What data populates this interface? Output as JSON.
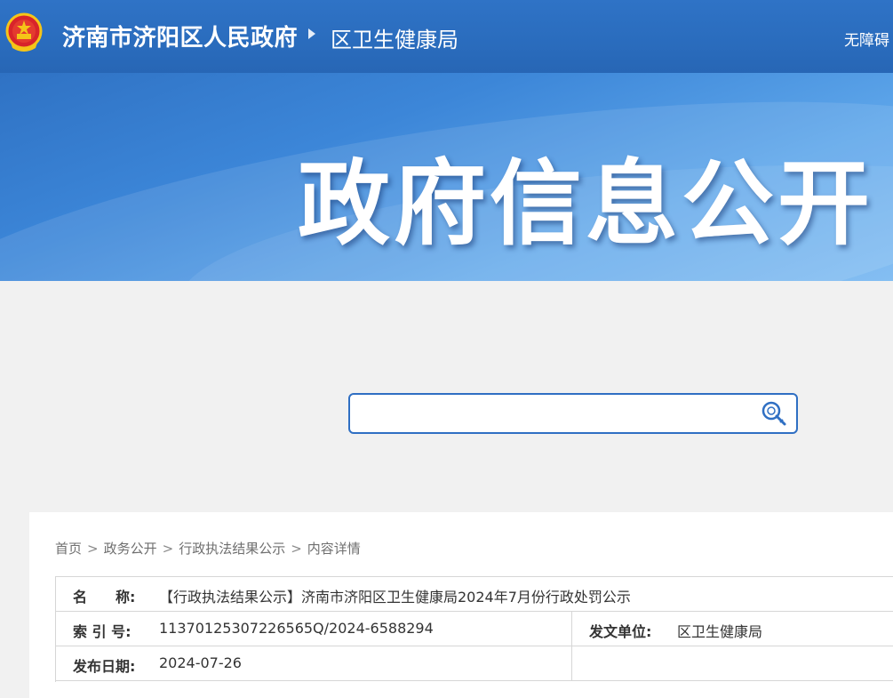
{
  "header": {
    "site_name": "济南市济阳区人民政府",
    "department": "区卫生健康局",
    "accessibility_link": "无障碍"
  },
  "banner": {
    "title": "政府信息公开"
  },
  "search": {
    "placeholder": ""
  },
  "breadcrumb": {
    "items": [
      "首页",
      "政务公开",
      "行政执法结果公示",
      "内容详情"
    ],
    "separator": ">"
  },
  "document_meta": {
    "name_label": "名　　称:",
    "name_value": "【行政执法结果公示】济南市济阳区卫生健康局2024年7月份行政处罚公示",
    "index_label": "索 引 号:",
    "index_value": "11370125307226565Q/2024-6588294",
    "issuer_label": "发文单位:",
    "issuer_value": "区卫生健康局",
    "date_label": "发布日期:",
    "date_value": "2024-07-26"
  },
  "colors": {
    "header_blue": "#2a6cbd",
    "banner_light": "#7ab9f1",
    "search_border": "#2f6fc3"
  },
  "icons": {
    "emblem": "national-emblem-icon",
    "search": "search-magnifier-icon",
    "arrow": "triangle-right-icon"
  }
}
